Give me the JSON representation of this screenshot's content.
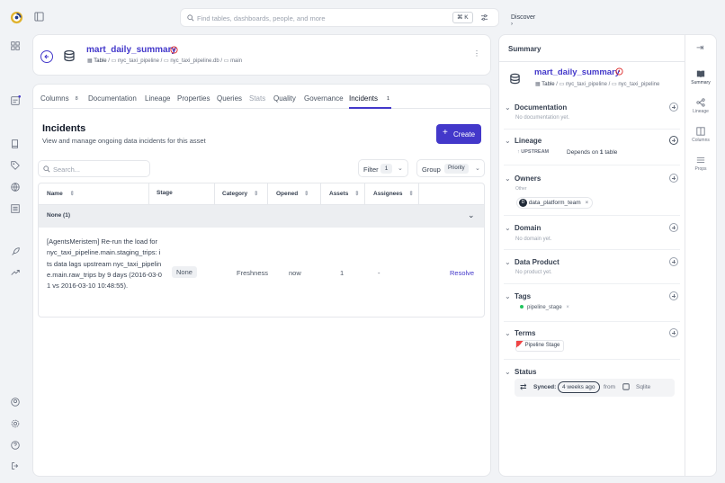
{
  "topbar": {
    "search_placeholder": "Find tables, dashboards, people, and more",
    "kbd": "⌘ K",
    "discover": "Discover"
  },
  "asset": {
    "name": "mart_daily_summary",
    "type": "Table",
    "schema": "nyc_taxi_pipeline",
    "db": "nyc_taxi_pipeline.db",
    "branch": "main"
  },
  "tabs": [
    {
      "label": "Columns",
      "count": "8"
    },
    {
      "label": "Documentation"
    },
    {
      "label": "Lineage"
    },
    {
      "label": "Properties"
    },
    {
      "label": "Queries"
    },
    {
      "label": "Stats"
    },
    {
      "label": "Quality"
    },
    {
      "label": "Governance"
    },
    {
      "label": "Incidents",
      "count": "1"
    }
  ],
  "incidents": {
    "title": "Incidents",
    "subtitle": "View and manage ongoing data incidents for this asset",
    "create_label": "Create",
    "search_placeholder": "Search...",
    "filter_label": "Filter",
    "filter_count": "1",
    "group_label": "Group",
    "group_value": "Priority"
  },
  "table": {
    "headers": [
      "Name",
      "Stage",
      "Category",
      "Opened",
      "Assets",
      "Assignees"
    ],
    "group_label": "None (1)",
    "row": {
      "name": "[AgentsMeristem] Re-run the load for nyc_taxi_pipeline.main.staging_trips: its data lags upstream nyc_taxi_pipeline.main.raw_trips by 9 days (2016-03-01 vs 2016-03-10 10:48:55).",
      "stage": "None",
      "category": "Freshness",
      "opened": "now",
      "assets": "1",
      "assignees": "-",
      "action": "Resolve"
    }
  },
  "summary": {
    "title": "Summary",
    "name": "mart_daily_summary",
    "type": "Table",
    "schema": "nyc_taxi_pipeline",
    "schema2": "nyc_taxi_pipeline",
    "documentation": {
      "title": "Documentation",
      "empty": "No documentation yet."
    },
    "lineage": {
      "title": "Lineage",
      "upstream": "UPSTREAM",
      "depends_prefix": "Depends on",
      "depends_count": "1",
      "depends_suffix": "table"
    },
    "owners": {
      "title": "Owners",
      "sub": "Other",
      "owner": "data_platform_team",
      "owner_initial": "D"
    },
    "domain": {
      "title": "Domain",
      "empty": "No domain yet."
    },
    "data_product": {
      "title": "Data Product",
      "empty": "No product yet."
    },
    "tags": {
      "title": "Tags",
      "tag": "pipeline_stage"
    },
    "terms": {
      "title": "Terms",
      "term": "Pipeline Stage"
    },
    "status": {
      "title": "Status",
      "synced": "Synced:",
      "ago": "4 weeks ago",
      "from": "from",
      "source": "Sqlite"
    }
  },
  "right_tabs": [
    "Summary",
    "Lineage",
    "Columns",
    "Props"
  ],
  "colors": {
    "accent": "#4338ca",
    "brand": "#e0b22c"
  }
}
